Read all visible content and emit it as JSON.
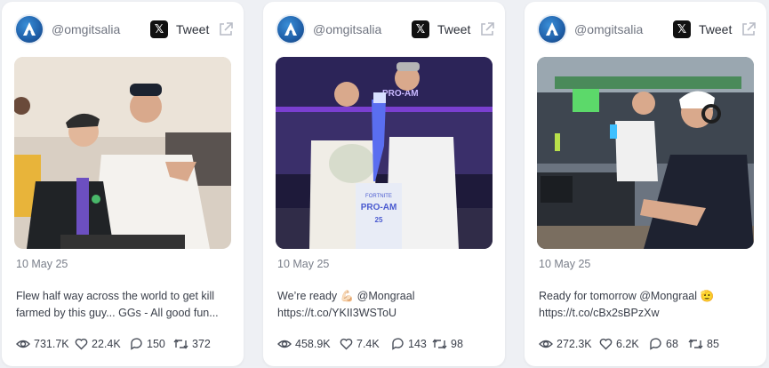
{
  "cards": [
    {
      "handle": "@omgitsalia",
      "tweet_label": "Tweet",
      "date": "10 May 25",
      "text_line1": "Flew half way across the world to get kill",
      "text_line2": "farmed by this guy... GGs - All good fun...",
      "views": "731.7K",
      "likes": "22.4K",
      "replies": "150",
      "retweets": "372"
    },
    {
      "handle": "@omgitsalia",
      "tweet_label": "Tweet",
      "date": "10 May 25",
      "text_line1": "We’re ready 💪🏻 @Mongraal",
      "text_line2": "https://t.co/YKII3WSToU",
      "views": "458.9K",
      "likes": "7.4K",
      "replies": "143",
      "retweets": "98",
      "photo_text": {
        "trophy_top": "PRO-AM",
        "trophy_mid": "FORTNITE",
        "trophy_main": "PRO-AM",
        "trophy_year": "25"
      }
    },
    {
      "handle": "@omgitsalia",
      "tweet_label": "Tweet",
      "date": "10 May 25",
      "text_line1": "Ready for tomorrow @Mongraal 🫡",
      "text_line2": "https://t.co/cBx2sBPzXw",
      "views": "272.3K",
      "likes": "6.2K",
      "replies": "68",
      "retweets": "85"
    }
  ],
  "icons": {
    "avatar": "omgitsalia-logo-icon",
    "x_logo": "x-logo-icon",
    "external": "external-link-icon",
    "views": "eye-icon",
    "likes": "heart-icon",
    "replies": "comment-icon",
    "retweets": "retweet-icon"
  },
  "colors": {
    "background": "#eef0f4",
    "card": "#ffffff",
    "accent_avatar": "#1f5fa8"
  }
}
